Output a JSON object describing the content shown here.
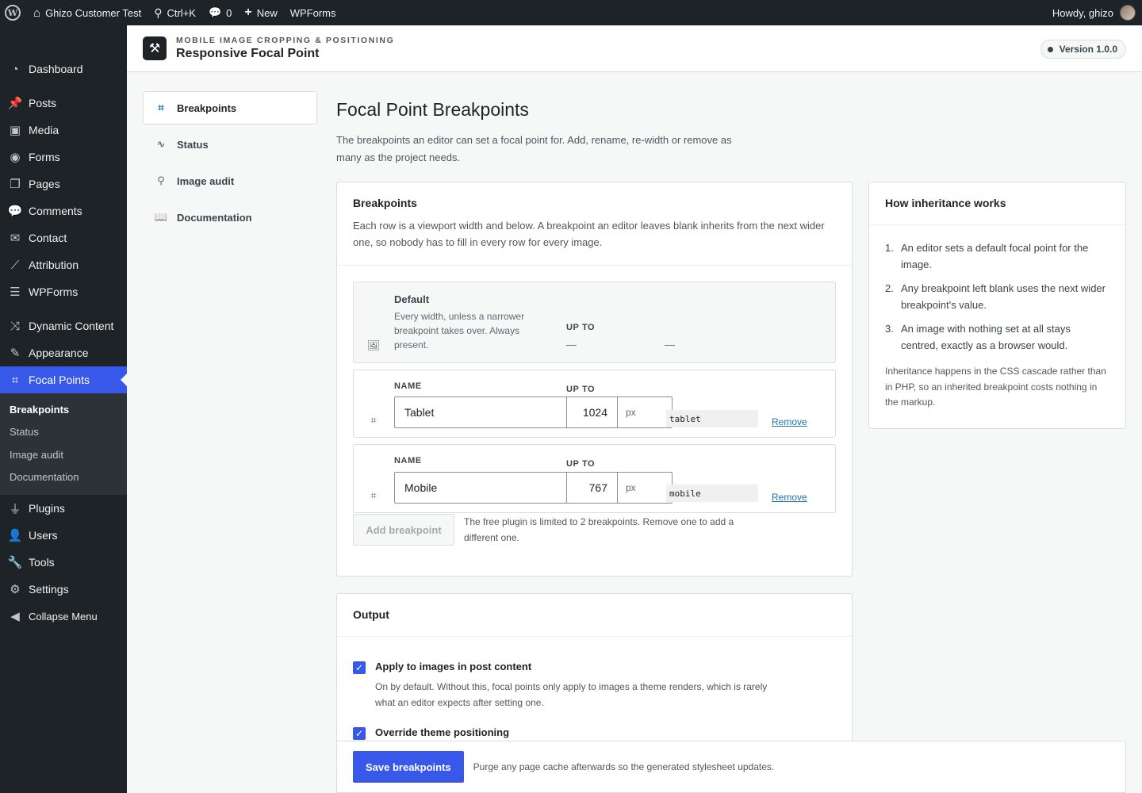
{
  "adminbar": {
    "site_name": "Ghizo Customer Test",
    "search_shortcut": "Ctrl+K",
    "comments_count": "0",
    "new_label": "New",
    "wpforms_label": "WPForms",
    "howdy": "Howdy, ghizo"
  },
  "sidebar": {
    "items": [
      {
        "label": "Dashboard",
        "icon": "dashboard-icon"
      },
      {
        "label": "Posts",
        "icon": "pin-icon"
      },
      {
        "label": "Media",
        "icon": "media-icon"
      },
      {
        "label": "Forms",
        "icon": "forms-icon"
      },
      {
        "label": "Pages",
        "icon": "pages-icon"
      },
      {
        "label": "Comments",
        "icon": "comment-icon"
      },
      {
        "label": "Contact",
        "icon": "mail-icon"
      },
      {
        "label": "Attribution",
        "icon": "chart-icon"
      },
      {
        "label": "WPForms",
        "icon": "wpforms-icon"
      },
      {
        "label": "Dynamic Content",
        "icon": "shuffle-icon"
      },
      {
        "label": "Appearance",
        "icon": "brush-icon"
      },
      {
        "label": "Focal Points",
        "icon": "crop-icon"
      },
      {
        "label": "Plugins",
        "icon": "plug-icon"
      },
      {
        "label": "Users",
        "icon": "user-icon"
      },
      {
        "label": "Tools",
        "icon": "wrench-icon"
      },
      {
        "label": "Settings",
        "icon": "settings-icon"
      },
      {
        "label": "Collapse Menu",
        "icon": "collapse-icon"
      }
    ],
    "submenu": [
      "Breakpoints",
      "Status",
      "Image audit",
      "Documentation"
    ]
  },
  "header": {
    "eyebrow": "MOBILE IMAGE CROPPING & POSITIONING",
    "title": "Responsive Focal Point",
    "version": "Version 1.0.0"
  },
  "nav": {
    "items": [
      "Breakpoints",
      "Status",
      "Image audit",
      "Documentation"
    ]
  },
  "main": {
    "title": "Focal Point Breakpoints",
    "description": "The breakpoints an editor can set a focal point for. Add, rename, re-width or remove as many as the project needs."
  },
  "breakpoints": {
    "title": "Breakpoints",
    "subtitle": "Each row is a viewport width and below. A breakpoint an editor leaves blank inherits from the next wider one, so nobody has to fill in every row for every image.",
    "default": {
      "name": "Default",
      "desc": "Every width, unless a narrower breakpoint takes over. Always present.",
      "upto_label": "UP TO",
      "upto_value": "—",
      "slug_value": "—"
    },
    "name_label": "NAME",
    "upto_label": "UP TO",
    "unit": "px",
    "remove_label": "Remove",
    "rows": [
      {
        "name": "Tablet",
        "width": "1024",
        "slug": "tablet"
      },
      {
        "name": "Mobile",
        "width": "767",
        "slug": "mobile"
      }
    ],
    "add_label": "Add breakpoint",
    "limit_note": "The free plugin is limited to 2 breakpoints. Remove one to add a different one."
  },
  "inheritance": {
    "title": "How inheritance works",
    "steps": [
      "An editor sets a default focal point for the image.",
      "Any breakpoint left blank uses the next wider breakpoint's value.",
      "An image with nothing set at all stays centred, exactly as a browser would."
    ],
    "footnote": "Inheritance happens in the CSS cascade rather than in PHP, so an inherited breakpoint costs nothing in the markup."
  },
  "output": {
    "title": "Output",
    "options": [
      {
        "label": "Apply to images in post content",
        "desc": "On by default. Without this, focal points only apply to images a theme renders, which is rarely what an editor expects after setting one.",
        "checked": true
      },
      {
        "label": "Override theme positioning",
        "desc": "",
        "checked": true
      }
    ]
  },
  "savebar": {
    "button": "Save breakpoints",
    "note": "Purge any page cache afterwards so the generated stylesheet updates."
  },
  "colors": {
    "accent": "#3858e9",
    "admin_dark": "#1d2327",
    "link": "#2271b1"
  }
}
